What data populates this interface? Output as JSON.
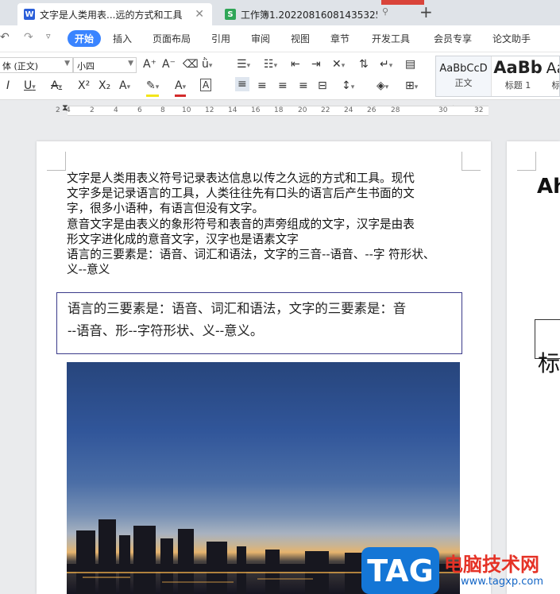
{
  "tabs": [
    {
      "label": "文字是人类用表...远的方式和工具",
      "icon": "W",
      "color": "#2b5fd9"
    },
    {
      "label": "工作簿1.20220816081435325",
      "icon": "S",
      "color": "#2fa657"
    }
  ],
  "ribbon_tabs": [
    "开始",
    "插入",
    "页面布局",
    "引用",
    "审阅",
    "视图",
    "章节",
    "开发工具",
    "会员专享",
    "论文助手"
  ],
  "toolbar": {
    "font_name": "体 (正文)",
    "font_size": "小四",
    "styles": [
      {
        "sample": "AaBbCcD",
        "name": "正文"
      },
      {
        "sample": "AaBb",
        "name": "标题 1"
      },
      {
        "sample": "Aa",
        "name": "标"
      }
    ]
  },
  "ruler": {
    "marks": [
      "2",
      "4",
      "2",
      "4",
      "6",
      "8",
      "10",
      "12",
      "14",
      "16",
      "18",
      "20",
      "22",
      "24",
      "26",
      "28",
      "30",
      "32"
    ]
  },
  "document": {
    "paragraphs": [
      "文字是人类用表义符号记录表达信息以传之久远的方式和工具。现代",
      "文字多是记录语言的工具，人类往往先有口头的语言后产生书面的文",
      "字，很多小语种，有语言但没有文字。",
      "意音文字是由表义的象形符号和表音的声旁组成的文字，汉字是由表",
      "形文字进化成的意音文字，汉字也是语素文字",
      "语言的三要素是：语音、词汇和语法，文字的三音--语音、--字  符形状、",
      "义--意义"
    ],
    "frame_text": [
      "语言的三要素是：语音、词汇和语法，文字的三要素是：音",
      "--语音、形--字符形状、义--意义。"
    ]
  },
  "page2": {
    "heading": "Ah",
    "label": "标"
  },
  "watermark": {
    "badge": "TAG",
    "name": "电脑技术网",
    "url": "www.tagxp.com"
  }
}
